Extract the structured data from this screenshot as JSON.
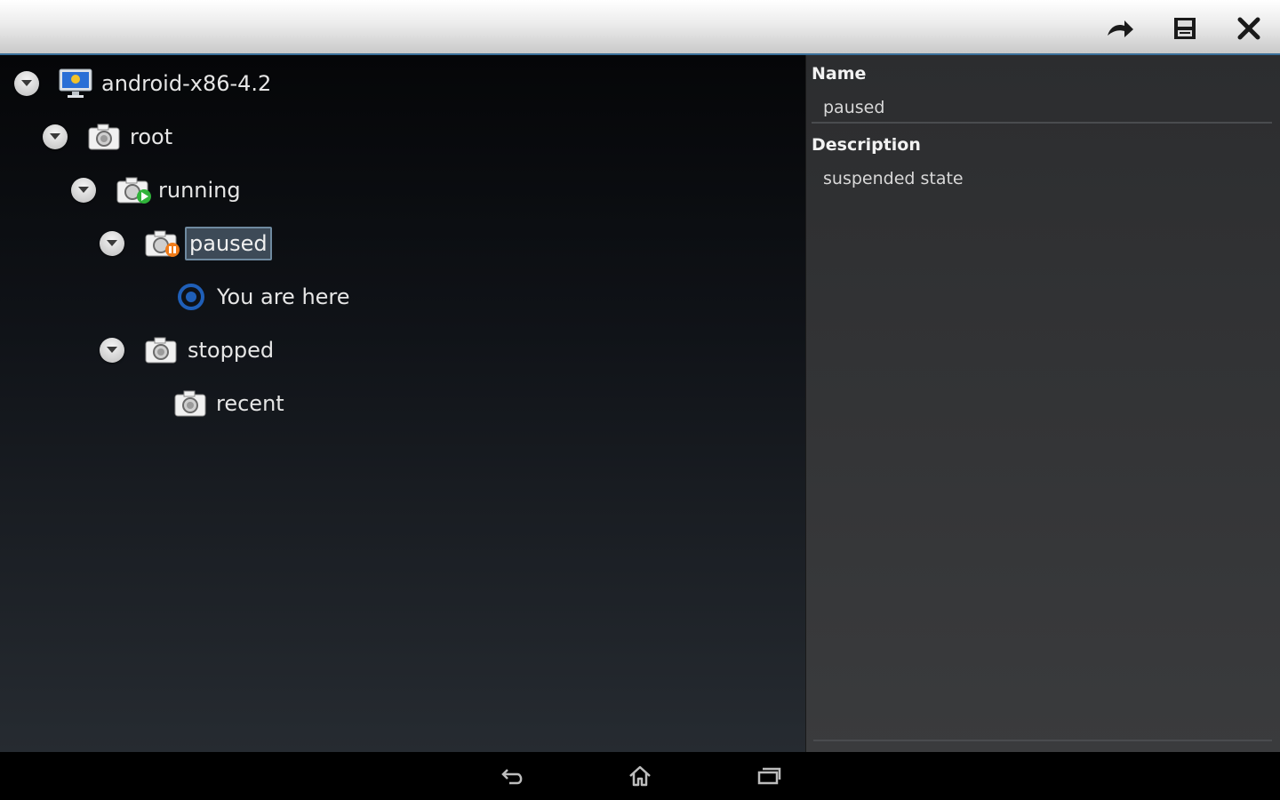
{
  "toolbar": {
    "actions": [
      {
        "name": "redo-arrow-icon"
      },
      {
        "name": "save-icon"
      },
      {
        "name": "close-icon"
      }
    ]
  },
  "tree": {
    "nodes": [
      {
        "label": "android-x86-4.2",
        "icon": "monitor-icon",
        "expandable": true,
        "level": 0
      },
      {
        "label": "root",
        "icon": "snapshot-camera-icon",
        "expandable": true,
        "level": 1
      },
      {
        "label": "running",
        "icon": "snapshot-running-icon",
        "expandable": true,
        "level": 2
      },
      {
        "label": "paused",
        "icon": "snapshot-paused-icon",
        "expandable": true,
        "level": 3,
        "selected": true
      },
      {
        "label": "You are here",
        "icon": "current-state-radio-icon",
        "expandable": false,
        "level": 4
      },
      {
        "label": "stopped",
        "icon": "snapshot-camera-icon",
        "expandable": true,
        "level": 3
      },
      {
        "label": "recent",
        "icon": "snapshot-camera-icon",
        "expandable": false,
        "level": 4
      }
    ]
  },
  "details": {
    "name_label": "Name",
    "name_value": "paused",
    "description_label": "Description",
    "description_value": "suspended state"
  },
  "navbar": {
    "buttons": [
      {
        "name": "back-icon"
      },
      {
        "name": "home-icon"
      },
      {
        "name": "recent-apps-icon"
      }
    ]
  },
  "colors": {
    "accent_border": "#3a6f9a",
    "selection_bg": "#3d4a57",
    "running_badge": "#2fb33a",
    "paused_badge": "#f07c1a",
    "radio_blue": "#1f5fb8"
  }
}
